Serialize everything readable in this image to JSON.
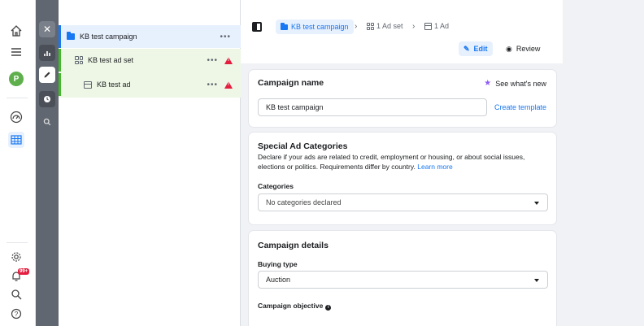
{
  "nav_rail": {
    "avatar_letter": "P",
    "notification_badge": "99+",
    "icons": [
      "home-icon",
      "menu-icon",
      "gauge-icon",
      "table-grid-icon",
      "gear-icon",
      "bell-icon",
      "search-icon",
      "help-icon"
    ],
    "accent": "#1877f2"
  },
  "tree": {
    "campaign": {
      "label": "KB test campaign"
    },
    "ad_set": {
      "label": "KB test ad set"
    },
    "ad": {
      "label": "KB test ad"
    }
  },
  "breadcrumb": {
    "campaign": "KB test campaign",
    "ad_set": "1 Ad set",
    "ad": "1 Ad"
  },
  "tabs": {
    "edit": "Edit",
    "review": "Review"
  },
  "campaign_name_card": {
    "title": "Campaign name",
    "whats_new": "See what's new",
    "value": "KB test campaign",
    "create_template": "Create template"
  },
  "special_ad_categories": {
    "title": "Special Ad Categories",
    "description": "Declare if your ads are related to credit, employment or housing, or about social issues, elections or politics. Requirements differ by country.",
    "learn_more": "Learn more",
    "categories_label": "Categories",
    "categories_value": "No categories declared"
  },
  "campaign_details": {
    "title": "Campaign details",
    "buying_type_label": "Buying type",
    "buying_type_value": "Auction",
    "objective_label": "Campaign objective"
  }
}
